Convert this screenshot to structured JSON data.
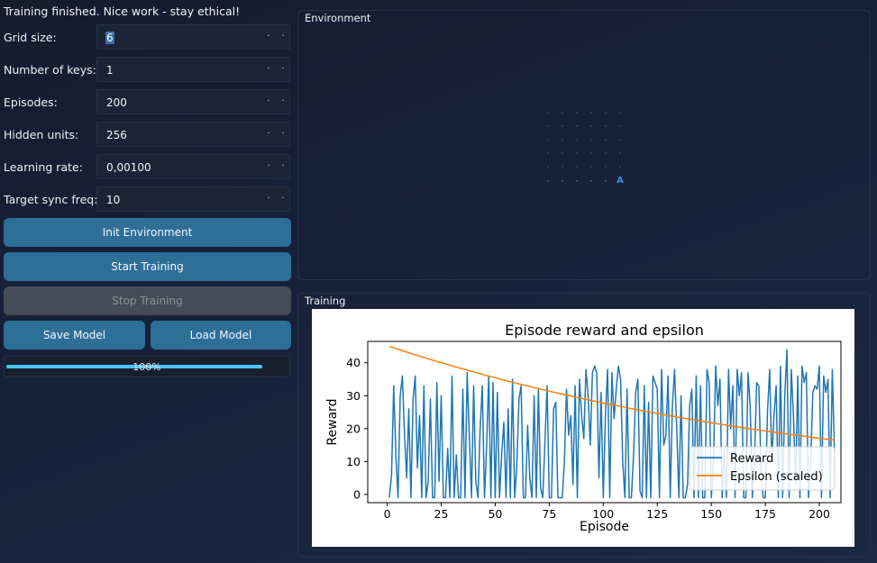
{
  "status": "Training finished. Nice work - stay ethical!",
  "params": [
    {
      "label": "Grid size:",
      "value": "6",
      "selected": true
    },
    {
      "label": "Number of keys:",
      "value": "1"
    },
    {
      "label": "Episodes:",
      "value": "200"
    },
    {
      "label": "Hidden units:",
      "value": "256"
    },
    {
      "label": "Learning rate:",
      "value": "0,00100"
    },
    {
      "label": "Target sync freq:",
      "value": "10"
    }
  ],
  "spin_arrow_glyph": "·",
  "buttons": {
    "init": "Init Environment",
    "start": "Start Training",
    "stop": "Stop Training",
    "save": "Save Model",
    "load": "Load Model"
  },
  "progress": {
    "value": 100,
    "text": "100%"
  },
  "environment": {
    "title": "Environment",
    "grid_rows": 6,
    "grid_cols": 6,
    "empty_glyph": "·",
    "last_row_glyph": "-",
    "agent_glyph": "A",
    "agent_row": 5,
    "agent_col": 5
  },
  "training": {
    "title": "Training"
  },
  "chart_data": {
    "type": "line",
    "title": "Episode reward and epsilon",
    "xlabel": "Episode",
    "ylabel": "Reward",
    "xlim": [
      -9,
      210
    ],
    "ylim": [
      -2.5,
      46.5
    ],
    "xticks": [
      0,
      25,
      50,
      75,
      100,
      125,
      150,
      175,
      200
    ],
    "yticks": [
      0,
      10,
      20,
      30,
      40
    ],
    "legend_position": "lower-right",
    "series": [
      {
        "name": "Reward",
        "color": "#1f77b4",
        "x_start": 1,
        "x_step": 1,
        "values": [
          -1,
          6,
          33,
          12,
          -1,
          30,
          36,
          18,
          5,
          26,
          -1,
          29,
          36,
          8,
          24,
          -1,
          33,
          -1,
          4,
          29,
          -1,
          -1,
          34,
          4,
          30,
          -1,
          -1,
          14,
          -1,
          36,
          -1,
          12,
          -1,
          -1,
          32,
          -1,
          37,
          18,
          -1,
          33,
          4,
          -1,
          20,
          33,
          -1,
          14,
          36,
          -1,
          34,
          -1,
          31,
          -1,
          12,
          22,
          -1,
          26,
          -1,
          35,
          -1,
          9,
          29,
          33,
          -1,
          -1,
          21,
          5,
          -1,
          30,
          -1,
          32,
          2,
          -1,
          16,
          33,
          -1,
          -1,
          26,
          28,
          -1,
          -1,
          -1,
          10,
          32,
          18,
          24,
          3,
          33,
          -1,
          35,
          24,
          17,
          38,
          30,
          15,
          37,
          39,
          37,
          5,
          31,
          -1,
          24,
          38,
          -1,
          37,
          23,
          32,
          39,
          35,
          10,
          -1,
          32,
          -1,
          -1,
          12,
          31,
          35,
          1,
          -1,
          33,
          -1,
          28,
          -1,
          36,
          34,
          32,
          -1,
          38,
          15,
          18,
          36,
          -1,
          27,
          38,
          20,
          -1,
          30,
          -1,
          -1,
          3,
          27,
          32,
          -1,
          36,
          -1,
          33,
          -1,
          -1,
          38,
          34,
          -1,
          10,
          39,
          27,
          35,
          -1,
          14,
          -1,
          38,
          20,
          33,
          -1,
          38,
          30,
          37,
          -1,
          -1,
          37,
          27,
          -1,
          11,
          34,
          33,
          8,
          -1,
          -1,
          25,
          38,
          10,
          24,
          33,
          -1,
          39,
          -1,
          30,
          44,
          -1,
          38,
          24,
          3,
          36,
          -1,
          39,
          34,
          37,
          -1,
          10,
          31,
          33,
          32,
          39,
          -1,
          36,
          31,
          35,
          -1,
          38,
          13
        ]
      },
      {
        "name": "Epsilon (scaled)",
        "color": "#ff7f0e",
        "x_start": 1,
        "x_step": 1,
        "start_value": 45,
        "end_value": 16.5
      }
    ]
  }
}
